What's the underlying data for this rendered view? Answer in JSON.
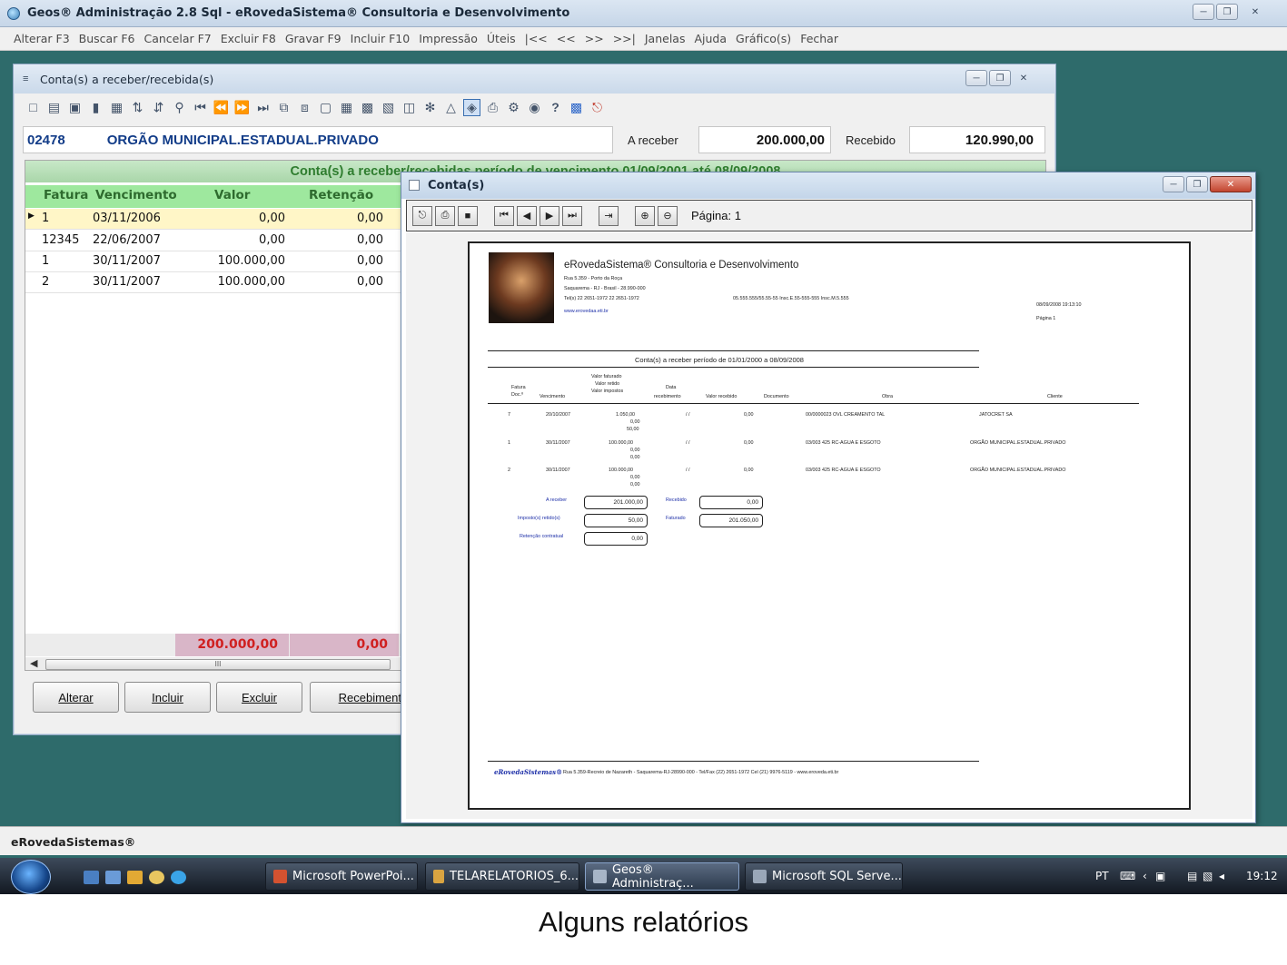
{
  "app": {
    "title": "Geos® Administração 2.8 Sql - eRovedaSistema® Consultoria e Desenvolvimento",
    "menu": [
      "Alterar F3",
      "Buscar F6",
      "Cancelar F7",
      "Excluir F8",
      "Gravar F9",
      "Incluir F10",
      "Impressão",
      "Úteis",
      "|<<",
      "<<",
      ">>",
      ">>|",
      "Janelas",
      "Ajuda",
      "Gráfico(s)",
      "Fechar"
    ]
  },
  "child": {
    "title": "Conta(s) a receber/recebida(s)",
    "code": "02478",
    "client": "ORGÃO MUNICIPAL.ESTADUAL.PRIVADO",
    "areceber_label": "A receber",
    "areceber_value": "200.000,00",
    "recebido_label": "Recebido",
    "recebido_value": "120.990,00",
    "grid_title": "Conta(s) a receber/recebidas período de vencimento 01/09/2001 até 08/09/2008",
    "columns": [
      "Fatura",
      "Vencimento",
      "Valor",
      "Retenção"
    ],
    "rows": [
      [
        "1",
        "03/11/2006",
        "0,00",
        "0,00"
      ],
      [
        "12345",
        "22/06/2007",
        "0,00",
        "0,00"
      ],
      [
        "1",
        "30/11/2007",
        "100.000,00",
        "0,00"
      ],
      [
        "2",
        "30/11/2007",
        "100.000,00",
        "0,00"
      ]
    ],
    "total_valor": "200.000,00",
    "total_retencao": "0,00",
    "scroll_glyph": "III",
    "buttons": {
      "alterar": "Alterar",
      "incluir": "Incluir",
      "excluir": "Excluir",
      "recebimento": "Recebiment"
    }
  },
  "report": {
    "title": "Conta(s)",
    "page_label": "Página: 1",
    "company": "eRovedaSistema® Consultoria e Desenvolvimento",
    "addr1": "Rua 5.359 - Porto da Roça",
    "addr2": "Saquarema - RJ - Brasil - 28.990-000",
    "phone": "Tel(s) 22 2651-1972 22 2651-1972",
    "web": "www.erovedaa.eti.br",
    "ids": "05.555.555/55.55-55 Insc.E.55-555-555 Insc.M.5.555",
    "date": "08/09/2008   19:13:10",
    "pagina": "Página    1",
    "heading": "Conta(s) a receber período de 01/01/2000 a 08/09/2008",
    "cols": {
      "fatura": [
        "Fatura",
        "Doc.º"
      ],
      "vencimento": "Vencimento",
      "valores": [
        "Valor faturado",
        "Valor retido",
        "Valor impostos"
      ],
      "data": [
        "Data",
        "recebimento"
      ],
      "valor_recebido": "Valor recebido",
      "documento": "Documento",
      "obra": "Obra",
      "cliente": "Cliente"
    },
    "rows": [
      {
        "fatura": "7",
        "venc": "20/10/2007",
        "v1": "1.050,00",
        "v2": "0,00",
        "v3": "50,00",
        "data": "/ /",
        "recebido": "0,00",
        "obra": "00/0000023 OVL CREAMENTO TAL",
        "cliente": "JATOCRET SA"
      },
      {
        "fatura": "1",
        "venc": "30/11/2007",
        "v1": "100.000,00",
        "v2": "0,00",
        "v3": "0,00",
        "data": "/ /",
        "recebido": "0,00",
        "obra": "03/003 425 RC-AGUA E ESGOTO",
        "cliente": "ORGÃO MUNICIPAL.ESTADUAL.PRIVADO"
      },
      {
        "fatura": "2",
        "venc": "30/11/2007",
        "v1": "100.000,00",
        "v2": "0,00",
        "v3": "0,00",
        "data": "/ /",
        "recebido": "0,00",
        "obra": "03/003 425 RC-AGUA E ESGOTO",
        "cliente": "ORGÃO MUNICIPAL.ESTADUAL.PRIVADO"
      }
    ],
    "totals": {
      "areceber_label": "A receber",
      "areceber": "201.000,00",
      "recebido_label": "Recebido",
      "recebido": "0,00",
      "impostos_label": "Imposto(s) retido(s)",
      "impostos": "50,00",
      "faturado_label": "Faturado",
      "faturado": "201.050,00",
      "retencao_label": "Retenção contratual",
      "retencao": "0,00"
    },
    "footer_brand": "eRovedaSistemas®",
    "footer_text": "Rua 5.359-Recreio de Nazareth - Saquarema-RJ-28990-000 - Tel/Fax (22) 2651-1972 Cel (21) 9976-5119 - www.eroveda.eti.br"
  },
  "status": {
    "text": "eRovedaSistemas®"
  },
  "taskbar": {
    "items": [
      "Microsoft PowerPoi...",
      "TELARELATORIOS_6...",
      "Geos® Administraç...",
      "Microsoft SQL Serve..."
    ],
    "lang": "PT",
    "time": "19:12"
  },
  "caption": "Alguns relatórios",
  "colors": {
    "desktop": "#2e6b6b",
    "grid_header": "#9ee89e",
    "total_text": "#d02020",
    "client_text": "#123c88"
  }
}
